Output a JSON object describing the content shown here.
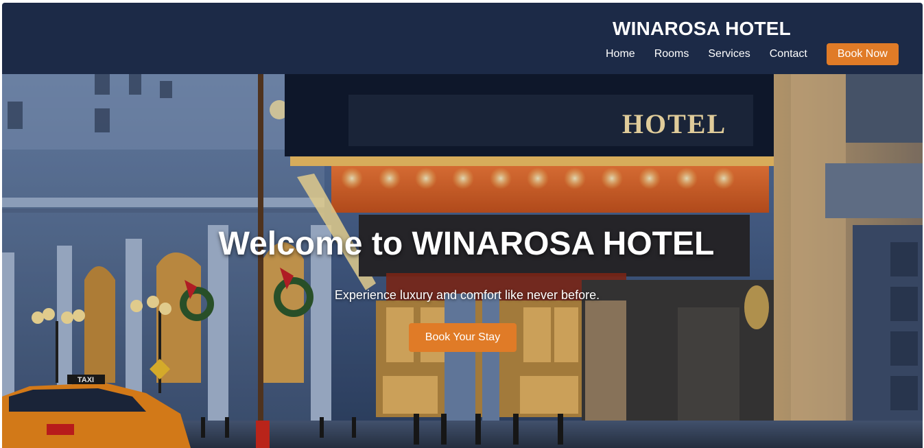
{
  "header": {
    "brand": "WINAROSA HOTEL",
    "nav": [
      {
        "label": "Home"
      },
      {
        "label": "Rooms"
      },
      {
        "label": "Services"
      },
      {
        "label": "Contact"
      }
    ],
    "cta_label": "Book Now"
  },
  "hero": {
    "title": "Welcome to WINAROSA HOTEL",
    "subtitle": "Experience luxury and comfort like never before.",
    "cta_label": "Book Your Stay",
    "sign_text": "HOTEL",
    "taxi_text": "TAXI"
  },
  "colors": {
    "header_bg": "#1c2a47",
    "accent": "#e07b27",
    "text": "#ffffff"
  }
}
